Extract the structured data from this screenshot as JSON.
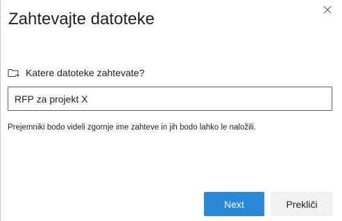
{
  "dialog": {
    "title": "Zahtevajte datoteke",
    "close_icon": "close-icon"
  },
  "form": {
    "question_icon": "folder-request-icon",
    "question": "Katere datoteke zahtevate?",
    "input_value": "RFP za projekt X",
    "help_text": "Prejemniki bodo videli zgornje ime zahteve in jih bodo lahko le naložili."
  },
  "actions": {
    "next_label": "Next",
    "cancel_label": "Prekliči"
  },
  "colors": {
    "primary": "#2b88d8",
    "secondary_bg": "#f3f2f1",
    "text": "#201f1e"
  }
}
